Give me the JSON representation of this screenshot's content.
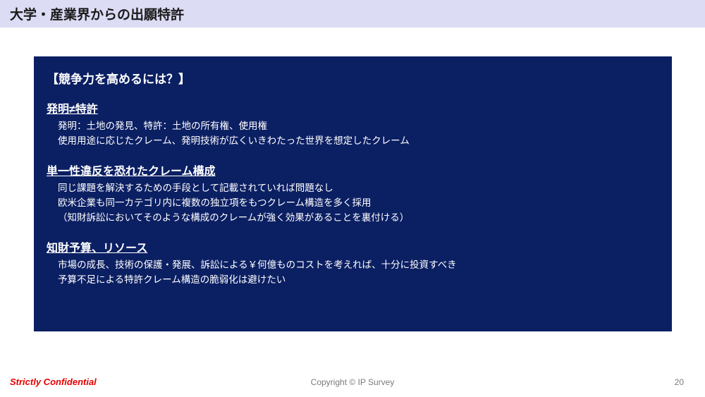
{
  "title": "大学・産業界からの出願特許",
  "panel": {
    "heading": "【競争力を高めるには？】",
    "sections": [
      {
        "head": "発明≠特許",
        "lines": [
          "発明：土地の発見、特許：土地の所有権、使用権",
          "使用用途に応じたクレーム、発明技術が広くいきわたった世界を想定したクレーム"
        ]
      },
      {
        "head": "単一性違反を恐れたクレーム構成",
        "lines": [
          "同じ課題を解決するための手段として記載されていれば問題なし",
          "欧米企業も同一カテゴリ内に複数の独立項をもつクレーム構造を多く採用",
          "（知財訴訟においてそのような構成のクレームが強く効果があることを裏付ける）"
        ]
      },
      {
        "head": "知財予算、リソース",
        "lines": [
          "市場の成長、技術の保護・発展、訴訟による￥何億ものコストを考えれば、十分に投資すべき",
          "予算不足による特許クレーム構造の脆弱化は避けたい"
        ]
      }
    ]
  },
  "footer": {
    "confidential": "Strictly Confidential",
    "copyright": "Copyright © IP Survey",
    "page": "20"
  }
}
